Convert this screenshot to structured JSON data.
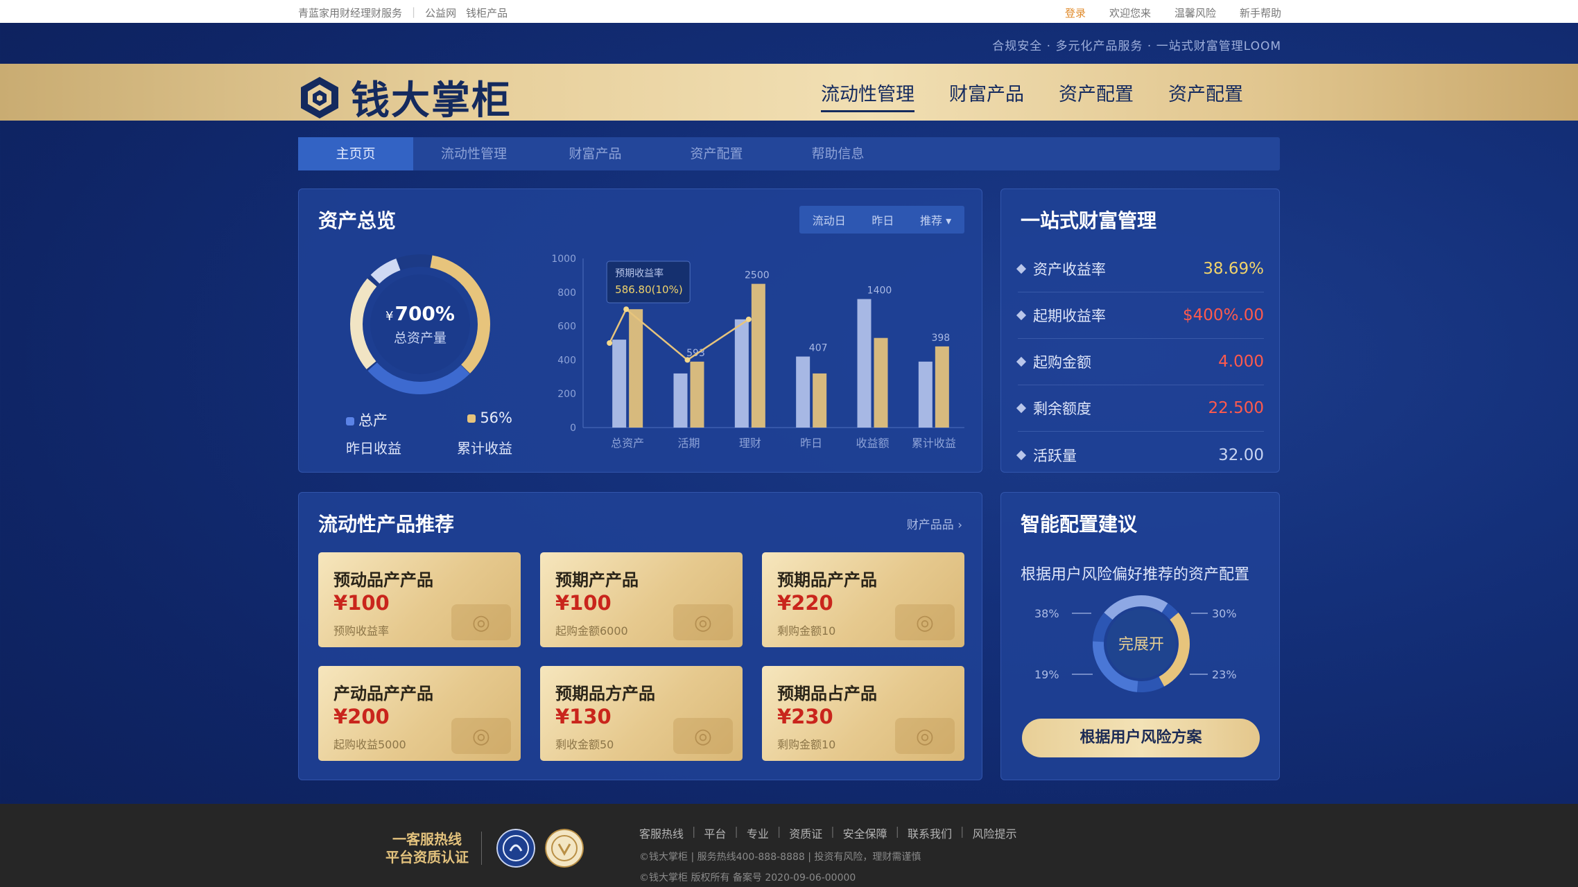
{
  "topbar": {
    "left_items": [
      "青蓝家用财经理财服务",
      "公益网",
      "钱柜产品"
    ],
    "right_items": [
      "登录",
      "欢迎您来",
      "温馨风险",
      "新手帮助"
    ]
  },
  "slogan": "合规安全 · 多元化产品服务 · 一站式财富管理LOOM",
  "brand": {
    "name": "钱大掌柜"
  },
  "main_nav": [
    {
      "label": "流动性管理",
      "active": true
    },
    {
      "label": "财富产品",
      "active": false
    },
    {
      "label": "资产配置",
      "active": false
    },
    {
      "label": "资产配置",
      "active": false
    }
  ],
  "sub_nav": [
    {
      "label": "主页页",
      "active": true
    },
    {
      "label": "流动性管理",
      "active": false
    },
    {
      "label": "财富产品",
      "active": false
    },
    {
      "label": "资产配置",
      "active": false
    },
    {
      "label": "帮助信息",
      "active": false
    }
  ],
  "asset_overview": {
    "title": "资产总览",
    "filters": [
      "流动日",
      "昨日",
      "推荐"
    ],
    "donut": {
      "currency": "¥",
      "value": "700%",
      "label": "总资产量"
    },
    "legend": [
      {
        "name": "总产",
        "sub": "昨日收益",
        "color": "#5b83e6"
      },
      {
        "name": "56%",
        "sub": "累计收益",
        "color": "#e7c47c"
      }
    ],
    "tooltip": {
      "title": "预期收益率",
      "value": "586.80(10%)"
    }
  },
  "chart_data": {
    "type": "bar",
    "categories": [
      "总资产",
      "活期",
      "理财",
      "昨日",
      "收益额",
      "累计收益"
    ],
    "series": [
      {
        "values": [
          520,
          320,
          640,
          420,
          760,
          390
        ],
        "color": "#b3c2ea"
      },
      {
        "values": [
          700,
          390,
          850,
          320,
          530,
          480
        ],
        "color": "#e7c47c"
      }
    ],
    "line": [
      700,
      400,
      640
    ],
    "data_labels": [
      "",
      "593",
      "2500",
      "407",
      "1400",
      "398"
    ],
    "yticks": [
      0,
      200,
      400,
      600,
      800,
      1000
    ],
    "ylim": [
      0,
      1000
    ]
  },
  "wealth": {
    "title": "一站式财富管理",
    "rows": [
      {
        "label": "资产收益率",
        "value": "38.69%",
        "color": "#f0d36b"
      },
      {
        "label": "起期收益率",
        "value": "$400%.00",
        "color": "#ff5a4d"
      },
      {
        "label": "起购金额",
        "value": "4.000",
        "color": "#ff5a4d"
      },
      {
        "label": "剩余额度",
        "value": "22.500",
        "color": "#ff5a4d"
      },
      {
        "label": "活跃量",
        "value": "32.00",
        "color": "#c8d4f2"
      }
    ]
  },
  "products": {
    "title": "流动性产品推荐",
    "more": "财产品品",
    "cards": [
      {
        "name": "预动品产产品",
        "price": "¥100",
        "note": "预购收益率"
      },
      {
        "name": "预期产产品",
        "price": "¥100",
        "note": "起购金额6000"
      },
      {
        "name": "预期品产产品",
        "price": "¥220",
        "note": "剩购金额10"
      },
      {
        "name": "产动品产产品",
        "price": "¥200",
        "note": "起购收益5000"
      },
      {
        "name": "预期品方产品",
        "price": "¥130",
        "note": "剩收金额50"
      },
      {
        "name": "预期品占产品",
        "price": "¥230",
        "note": "剩购金额10"
      }
    ]
  },
  "smart": {
    "title": "智能配置建议",
    "desc": "根据用户风险偏好推荐的资产配置",
    "center": "完展开",
    "labels": [
      "38%",
      "30%",
      "19%",
      "23%"
    ],
    "cta": "根据用户风险方案"
  },
  "footer": {
    "hotline": [
      "一客服热线",
      "平台资质认证"
    ],
    "links": [
      "客服热线",
      "平台",
      "专业",
      "资质证",
      "安全保障",
      "联系我们",
      "风险提示"
    ],
    "copy": [
      "©钱大掌柜 | 服务热线400-888-8888 | 投资有风险，理财需谨慎",
      "©钱大掌柜 版权所有 备案号 2020-09-06-00000"
    ]
  }
}
